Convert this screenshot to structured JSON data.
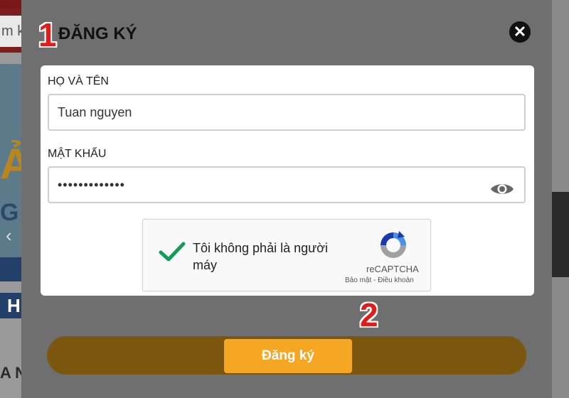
{
  "background": {
    "search_text": "m k",
    "hero_text_1": "Ả",
    "hero_text_2": "G",
    "arrow": "‹",
    "btn_letter": "H",
    "bottom_text": "A N"
  },
  "modal": {
    "title": "ĐĂNG KÝ",
    "close_symbol": "✕"
  },
  "annotations": {
    "step1": "1",
    "step2": "2"
  },
  "form": {
    "name_label": "HỌ VÀ TÊN",
    "name_value": "Tuan nguyen",
    "password_label": "MẬT KHẨU",
    "password_value": "•••••••••••••"
  },
  "recaptcha": {
    "label": "Tôi không phải là người máy",
    "brand": "reCAPTCHA",
    "links": "Bảo mật - Điều khoản"
  },
  "submit": {
    "label": "Đăng ký"
  },
  "colors": {
    "accent": "#f5a623",
    "annotation": "#e21b1b",
    "check": "#0f9d58"
  }
}
